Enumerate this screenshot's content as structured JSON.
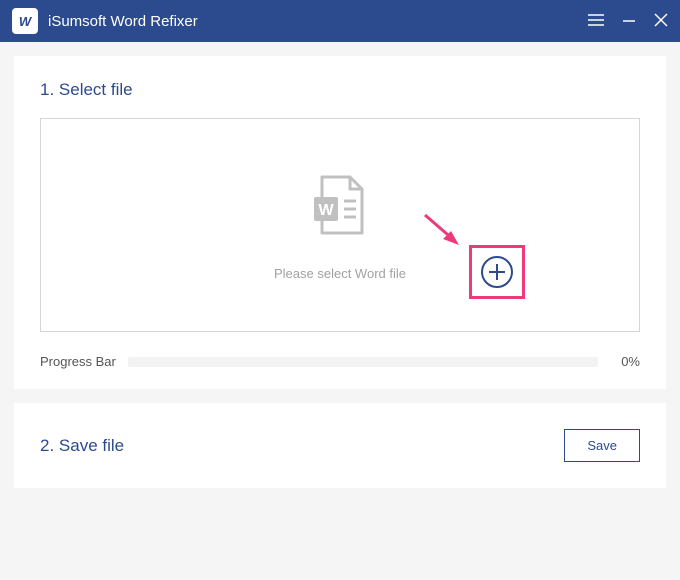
{
  "titlebar": {
    "app_title": "iSumsoft Word Refixer",
    "icon_text": "W"
  },
  "step1": {
    "heading": "1. Select file",
    "prompt": "Please select Word file",
    "progress_label": "Progress Bar",
    "progress_percent": "0%"
  },
  "step2": {
    "heading": "2. Save file",
    "save_label": "Save"
  }
}
